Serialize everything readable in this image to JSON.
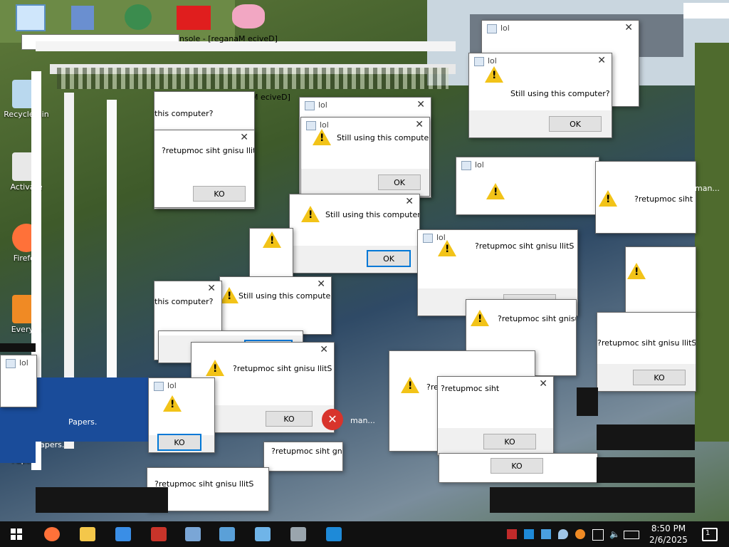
{
  "desktop": {
    "icons": [
      {
        "label": "Recycle Bin",
        "name": "recycle-bin-icon",
        "color": "#b9d8ee"
      },
      {
        "label": "Activate",
        "name": "activate-icon",
        "color": "#e8e8e8"
      },
      {
        "label": "Firefox",
        "name": "firefox-icon",
        "color": "#ff7139"
      },
      {
        "label": "Everyth",
        "name": "everything-icon",
        "color": "#f08a24"
      },
      {
        "label": "Papers.",
        "name": "papers-icon",
        "color": "#2a6bc4"
      },
      {
        "label": "Firefox",
        "name": "firefox-icon",
        "color": "#ff7139"
      },
      {
        "label": "Papers.",
        "name": "papers-icon",
        "color": "#2a6bc4"
      }
    ],
    "top_icons": [
      {
        "name": "computer-icon",
        "color": "#cfe6fb"
      },
      {
        "name": "installer-icon",
        "color": "#6a8fd0"
      },
      {
        "name": "character-icon",
        "color": "#3b8c4e"
      },
      {
        "name": "mcdonalds-icon",
        "color": "#e01e1e"
      },
      {
        "name": "pig-icon",
        "color": "#f2a7c3"
      }
    ]
  },
  "dialog": {
    "title": "lol",
    "message": "Still using this computer?",
    "message_mirrored": "?retupmoc siht gnisu llitS",
    "button": "OK",
    "button_mirrored": "KO",
    "close": "✕"
  },
  "fragments": {
    "console_title": "nsole - [reganaM eciveD]",
    "still_fragment": "this computer?",
    "still_short": "Still",
    "still_p": "Stil",
    "mirror_partial": "?retupmoc siht",
    "mirror_partial2": "?retupmoc siht gnisu l",
    "papers": "Papers.",
    "manager": "man...",
    "recycle": "Recy",
    "activ": "Activ"
  },
  "taskbar": {
    "apps": [
      {
        "name": "firefox-taskbar-icon",
        "color": "#ff7139"
      },
      {
        "name": "file-explorer-taskbar-icon",
        "color": "#f4c74a"
      },
      {
        "name": "app-blue-taskbar-icon",
        "color": "#3a8ee6"
      },
      {
        "name": "toolbox-taskbar-icon",
        "color": "#c9342a"
      },
      {
        "name": "control-panel-taskbar-icon",
        "color": "#7aa6d6"
      },
      {
        "name": "picture-taskbar-icon",
        "color": "#5aa0d8"
      },
      {
        "name": "notepad-taskbar-icon",
        "color": "#6fb4e8"
      },
      {
        "name": "device-taskbar-icon",
        "color": "#9aa5ad"
      },
      {
        "name": "sync-taskbar-icon",
        "color": "#1e8ad8"
      }
    ],
    "clock_time": "8:50 PM",
    "clock_date": "2/6/2025",
    "notification_count": "1"
  }
}
